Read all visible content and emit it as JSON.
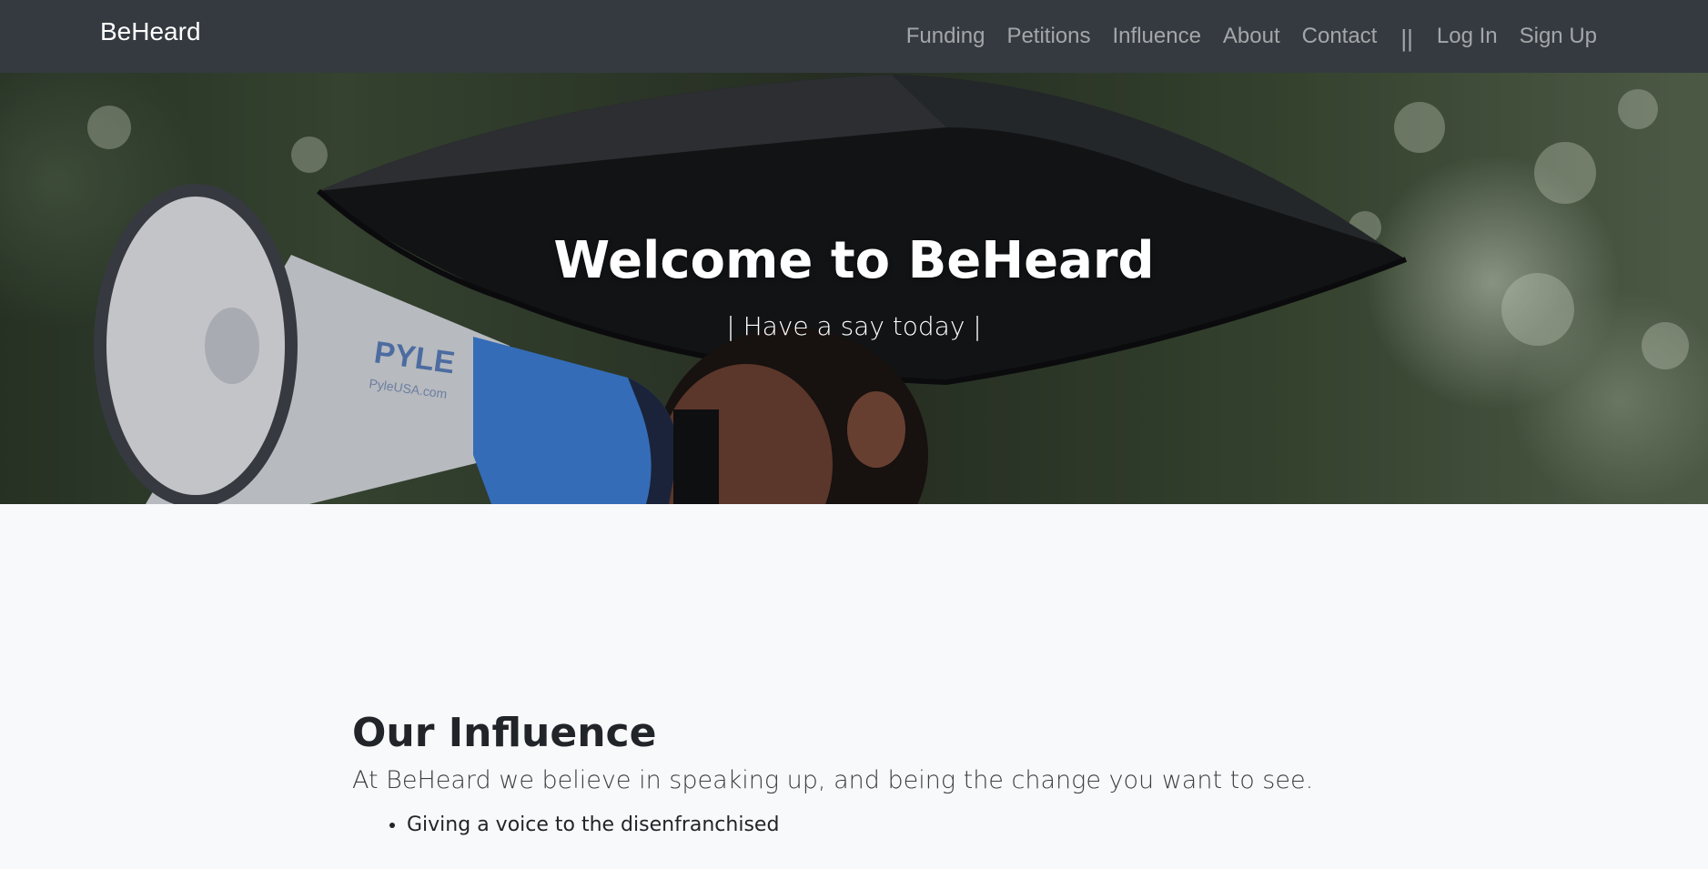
{
  "navbar": {
    "brand": "BeHeard",
    "links": [
      {
        "label": "Funding"
      },
      {
        "label": "Petitions"
      },
      {
        "label": "Influence"
      },
      {
        "label": "About"
      },
      {
        "label": "Contact"
      }
    ],
    "separator": "||",
    "login_label": "Log In",
    "signup_label": "Sign Up"
  },
  "hero": {
    "title": "Welcome to BeHeard",
    "subtitle": "| Have a say today |",
    "megaphone_brand": "PYLE",
    "megaphone_url": "PyleUSA.com"
  },
  "influence": {
    "heading": "Our Influence",
    "lead": "At BeHeard we believe in speaking up, and being the change you want to see.",
    "items": [
      {
        "text": "Giving a voice to the disenfranchised"
      }
    ]
  },
  "colors": {
    "navbar_bg": "#343a40",
    "page_bg": "#f8f9fa",
    "nav_text": "rgba(255,255,255,0.55)",
    "megaphone_blue": "#3f7fd8"
  }
}
